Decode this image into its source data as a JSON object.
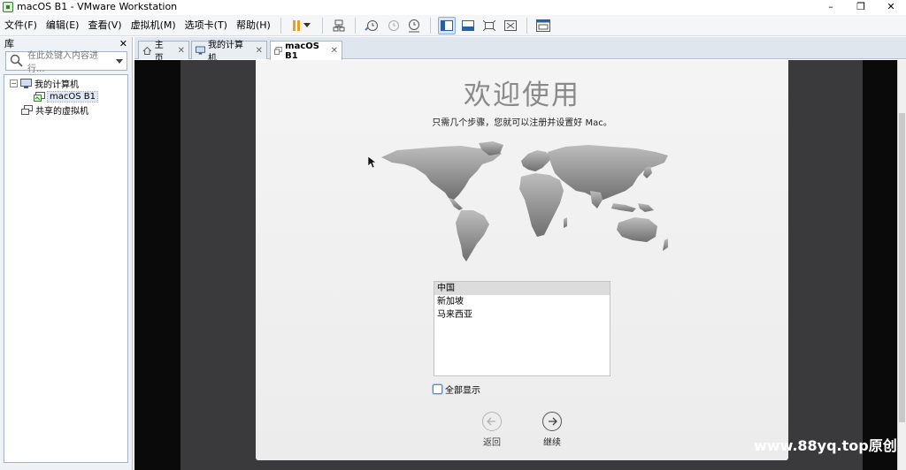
{
  "window": {
    "title": "macOS B1 - VMware Workstation",
    "controls": {
      "minimize": "–",
      "maximize": "❐",
      "close": "✕"
    }
  },
  "menu": [
    "文件(F)",
    "编辑(E)",
    "查看(V)",
    "虚拟机(M)",
    "选项卡(T)",
    "帮助(H)"
  ],
  "library": {
    "title": "库",
    "close": "✕",
    "search_placeholder": "在此处键入内容进行...",
    "tree": {
      "my_computer": "我的计算机",
      "vm": "macOS B1",
      "shared": "共享的虚拟机"
    }
  },
  "tabs": [
    {
      "label": "主页",
      "close": "✕"
    },
    {
      "label": "我的计算机",
      "close": "✕"
    },
    {
      "label": "macOS B1",
      "close": "✕"
    }
  ],
  "setup": {
    "title": "欢迎使用",
    "subtitle": "只需几个步骤，您就可以注册并设置好 Mac。",
    "countries": [
      "中国",
      "新加坡",
      "马来西亚"
    ],
    "selected_country": "中国",
    "show_all_label": "全部显示",
    "show_all_checked": false,
    "back_label": "返回",
    "next_label": "继续"
  },
  "watermark": "www.88yq.top原创",
  "colors": {
    "accent": "#4d8fd6",
    "pause": "#e8a020",
    "vm_bg": "#3a3a3c"
  }
}
